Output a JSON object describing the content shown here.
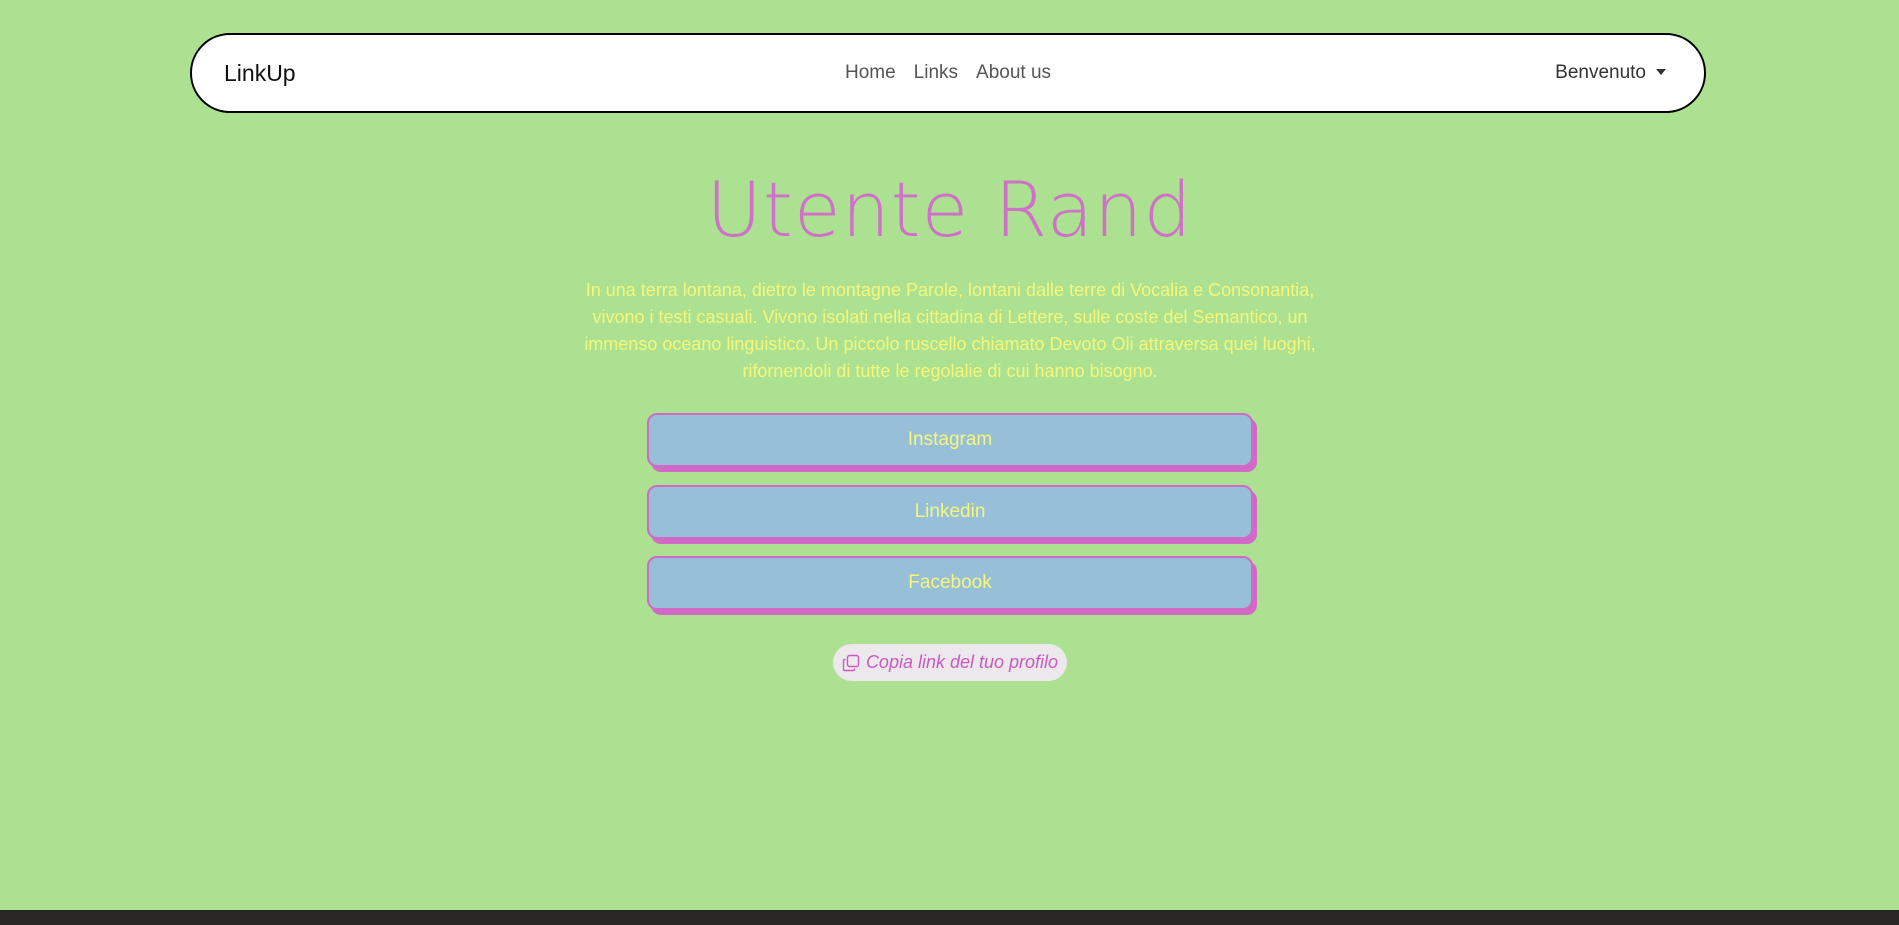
{
  "navbar": {
    "brand": "LinkUp",
    "links": [
      "Home",
      "Links",
      "About us"
    ],
    "dropdown_label": "Benvenuto"
  },
  "profile": {
    "name": "Utente Rand",
    "bio": "In una terra lontana, dietro le montagne Parole, lontani dalle terre di Vocalia e Consonantia, vivono i testi casuali. Vivono isolati nella cittadina di Lettere, sulle coste del Semantico, un immenso oceano linguistico. Un piccolo ruscello chiamato Devoto Oli attraversa quei luoghi, rifornendoli di tutte le regolalie di cui hanno bisogno."
  },
  "links": [
    {
      "label": "Instagram"
    },
    {
      "label": "Linkedin"
    },
    {
      "label": "Facebook"
    }
  ],
  "copy_button": {
    "label": "Copia link del tuo profilo",
    "icon": "copy-icon"
  },
  "colors": {
    "background": "#abe190",
    "accent": "#d070c8",
    "text_yellow": "#f6f77a",
    "button_fill": "#97bfd8"
  }
}
